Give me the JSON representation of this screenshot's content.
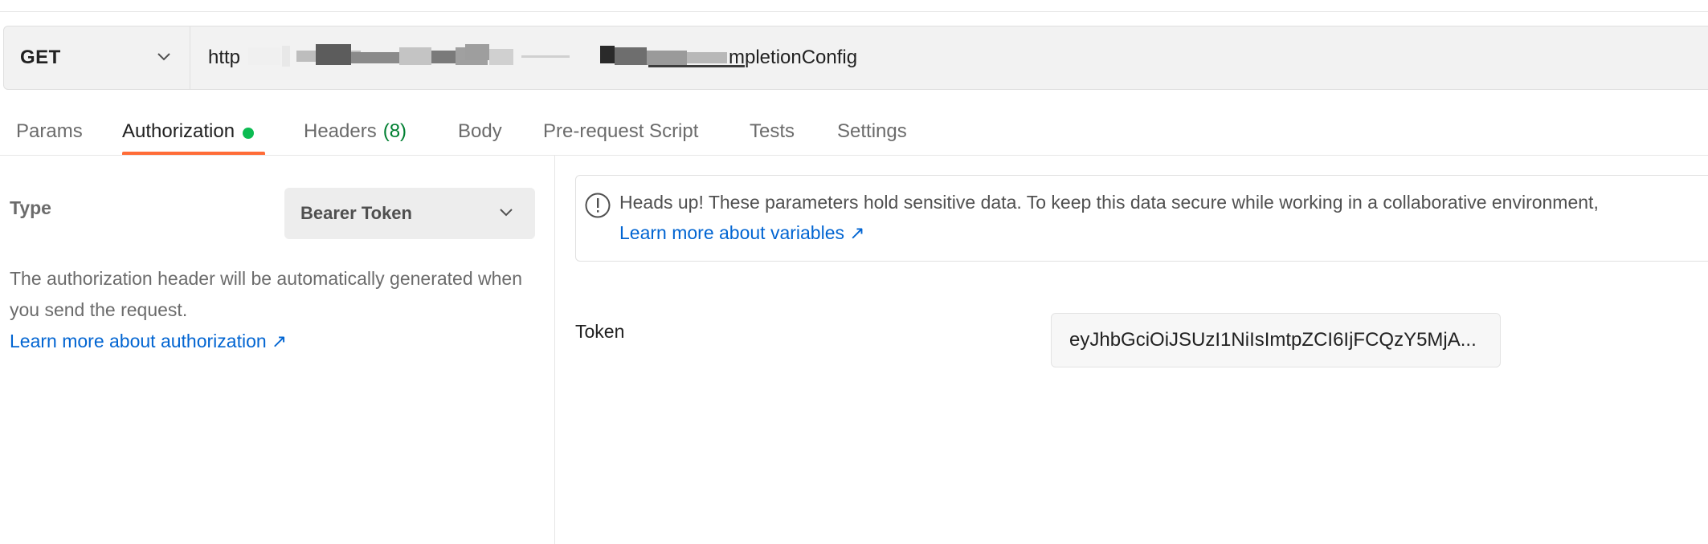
{
  "request": {
    "method": "GET",
    "url_visible": "http",
    "url_tail": "mpletionConfig"
  },
  "tabs": [
    {
      "label": "Params"
    },
    {
      "label": "Authorization",
      "indicator": "active-dot"
    },
    {
      "label": "Headers",
      "count": "(8)"
    },
    {
      "label": "Body"
    },
    {
      "label": "Pre-request Script"
    },
    {
      "label": "Tests"
    },
    {
      "label": "Settings"
    }
  ],
  "auth": {
    "type_label": "Type",
    "type_value": "Bearer Token",
    "description": "The authorization header will be automatically generated when you send the request.",
    "learn_link": "Learn more about authorization ↗"
  },
  "alert": {
    "text": "Heads up! These parameters hold sensitive data. To keep this data secure while working in a collaborative environment,",
    "link": "Learn more about variables ↗"
  },
  "token": {
    "label": "Token",
    "value": "eyJhbGciOiJSUzI1NiIsImtpZCI6IjFCQzY5MjA..."
  },
  "colors": {
    "accent": "#ff6c37",
    "success_dot": "#0cbb52",
    "count_green": "#007f31",
    "link_blue": "#0265d2"
  }
}
